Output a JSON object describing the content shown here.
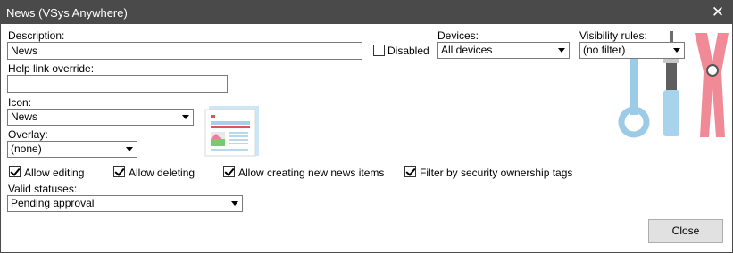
{
  "window": {
    "title": "News (VSys Anywhere)"
  },
  "form": {
    "description_label": "Description:",
    "description_value": "News",
    "disabled_label": "Disabled",
    "disabled_checked": false,
    "devices_label": "Devices:",
    "devices_value": "All devices",
    "visibility_label": "Visibility rules:",
    "visibility_value": "(no filter)",
    "help_link_label": "Help link override:",
    "help_link_value": "",
    "icon_label": "Icon:",
    "icon_value": "News",
    "overlay_label": "Overlay:",
    "overlay_value": "(none)",
    "checkboxes": [
      {
        "label": "Allow editing",
        "checked": true
      },
      {
        "label": "Allow deleting",
        "checked": true
      },
      {
        "label": "Allow creating new news items",
        "checked": true
      },
      {
        "label": "Filter by security ownership tags",
        "checked": true
      }
    ],
    "valid_statuses_label": "Valid statuses:",
    "valid_statuses_value": "Pending approval"
  },
  "footer": {
    "close_label": "Close"
  },
  "icons": {
    "titlebar_close": "close-icon",
    "icon_preview": "news-icon",
    "watermark": "tools-watermark-icon"
  },
  "colors": {
    "titlebar": "#4a4a4a",
    "accent_blue": "#8fc6e6",
    "accent_red": "#ef7a86"
  }
}
